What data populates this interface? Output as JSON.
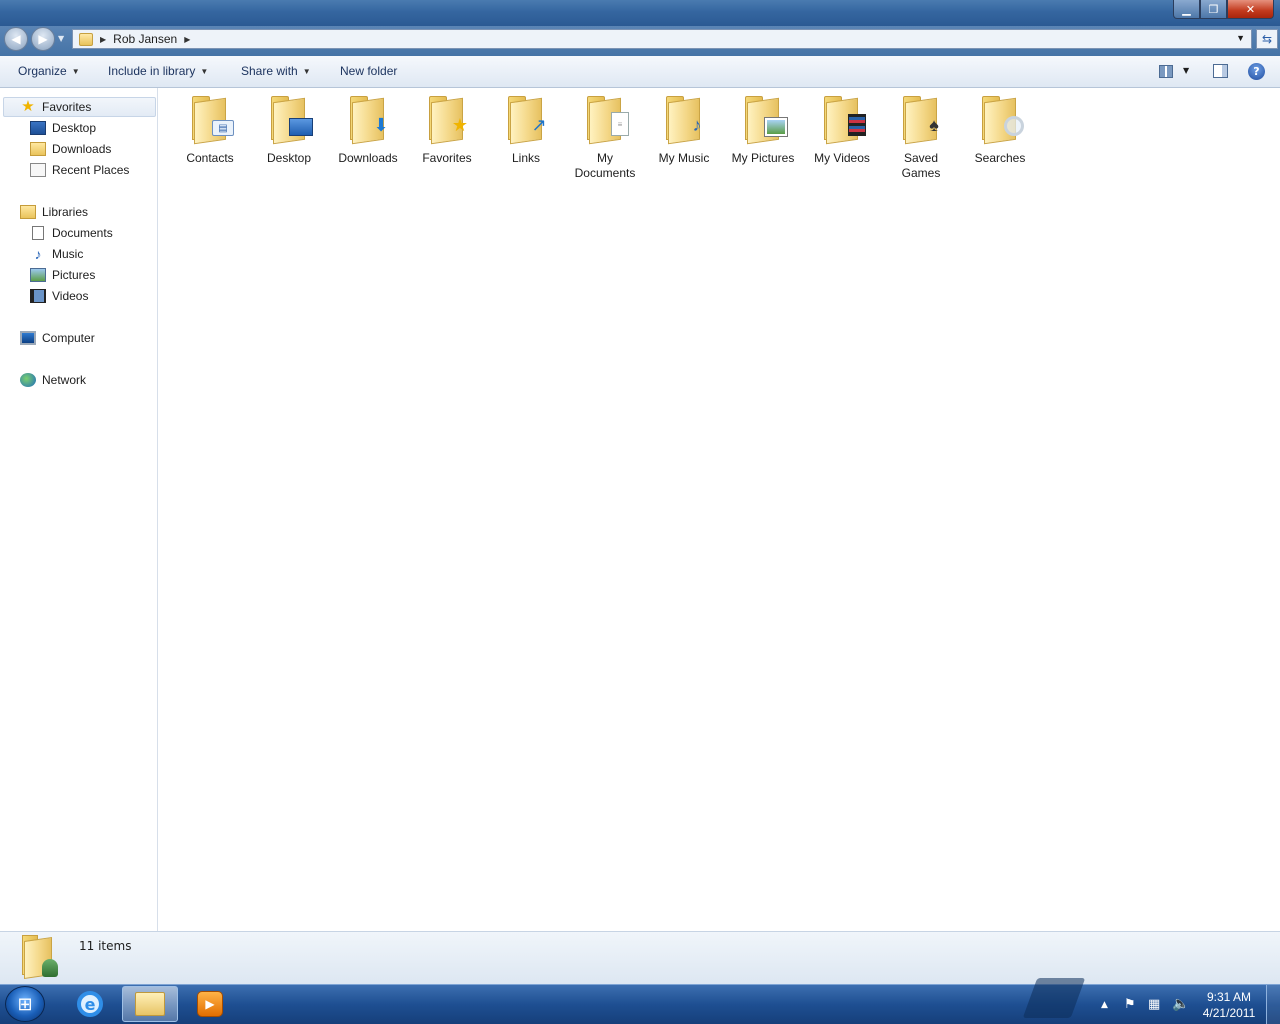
{
  "window": {
    "controls": {
      "minimize": "▁",
      "maximize": "❐",
      "close": "✕"
    }
  },
  "address": {
    "crumbs": [
      "Rob Jansen"
    ],
    "dropdown": "▼",
    "refresh": "⇆"
  },
  "toolbar": {
    "organize": "Organize",
    "include_in_library": "Include in library",
    "share_with": "Share with",
    "new_folder": "New folder"
  },
  "nav": {
    "favorites": {
      "label": "Favorites",
      "items": [
        "Desktop",
        "Downloads",
        "Recent Places"
      ]
    },
    "libraries": {
      "label": "Libraries",
      "items": [
        "Documents",
        "Music",
        "Pictures",
        "Videos"
      ]
    },
    "computer": "Computer",
    "network": "Network"
  },
  "folders": [
    {
      "name": "Contacts",
      "icon": "contacts-icon"
    },
    {
      "name": "Desktop",
      "icon": "desktop-icon"
    },
    {
      "name": "Downloads",
      "icon": "downloads-icon"
    },
    {
      "name": "Favorites",
      "icon": "favorites-icon"
    },
    {
      "name": "Links",
      "icon": "links-icon"
    },
    {
      "name": "My Documents",
      "icon": "documents-icon"
    },
    {
      "name": "My Music",
      "icon": "music-icon"
    },
    {
      "name": "My Pictures",
      "icon": "pictures-icon"
    },
    {
      "name": "My Videos",
      "icon": "videos-icon"
    },
    {
      "name": "Saved Games",
      "icon": "saved-games-icon"
    },
    {
      "name": "Searches",
      "icon": "searches-icon"
    }
  ],
  "status": {
    "item_count": "11 items"
  },
  "taskbar": {
    "time": "9:31 AM",
    "date": "4/21/2011"
  }
}
